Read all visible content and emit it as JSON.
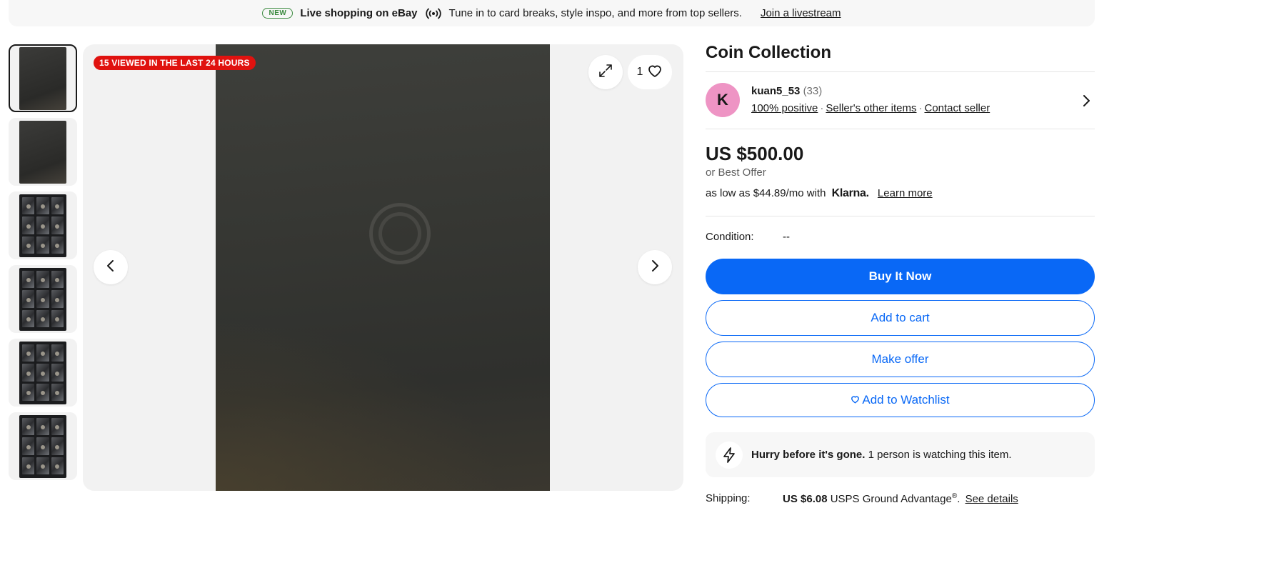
{
  "banner": {
    "badge": "NEW",
    "heading": "Live shopping on eBay",
    "text": "Tune in to card breaks, style inspo, and more from top sellers.",
    "link": "Join a livestream"
  },
  "gallery": {
    "views_badge": "15 VIEWED IN THE LAST 24 HOURS",
    "watch_count": "1",
    "thumbnail_count": 6,
    "selected_index": 0
  },
  "item": {
    "title": "Coin Collection"
  },
  "seller": {
    "initial": "K",
    "name": "kuan5_53",
    "feedback_count": "(33)",
    "positive": "100% positive",
    "other_items": "Seller's other items",
    "contact": "Contact seller"
  },
  "pricing": {
    "price": "US $500.00",
    "best_offer": "or Best Offer",
    "klarna_prefix": "as low as $44.89/mo with",
    "klarna_brand": "Klarna.",
    "learn_more": "Learn more"
  },
  "condition": {
    "label": "Condition:",
    "value": "--"
  },
  "actions": {
    "buy_now": "Buy It Now",
    "add_to_cart": "Add to cart",
    "make_offer": "Make offer",
    "add_to_watchlist": "Add to Watchlist"
  },
  "urgency": {
    "heading": "Hurry before it's gone.",
    "text": "1 person is watching this item."
  },
  "shipping": {
    "label": "Shipping:",
    "price": "US $6.08",
    "service": "USPS Ground Advantage",
    "trademark": "®",
    "link": "See details"
  },
  "colors": {
    "primary_blue": "#0968f6",
    "badge_red": "#e0120f",
    "avatar_pink": "#ee94c4",
    "new_badge_green": "#3a8a3e"
  }
}
